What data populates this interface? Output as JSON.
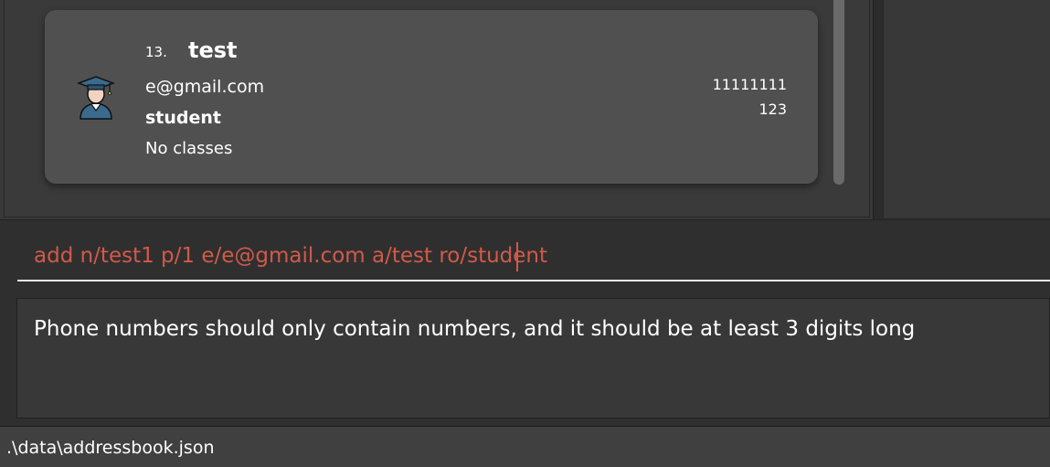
{
  "person_list": {
    "cards": [
      {
        "index": "13.",
        "name": "test",
        "email": "e@gmail.com",
        "role": "student",
        "classes": "No classes",
        "phone": "11111111",
        "extra": "123",
        "avatar_icon": "graduate-student-icon"
      }
    ]
  },
  "command_box": {
    "value": "add n/test1 p/1 e/e@gmail.com a/test ro/student",
    "text_color": "#d15a4a"
  },
  "result_display": {
    "message": "Phone numbers should only contain numbers, and it should be at least 3 digits long"
  },
  "status_bar": {
    "file_path": ".\\data\\addressbook.json"
  }
}
